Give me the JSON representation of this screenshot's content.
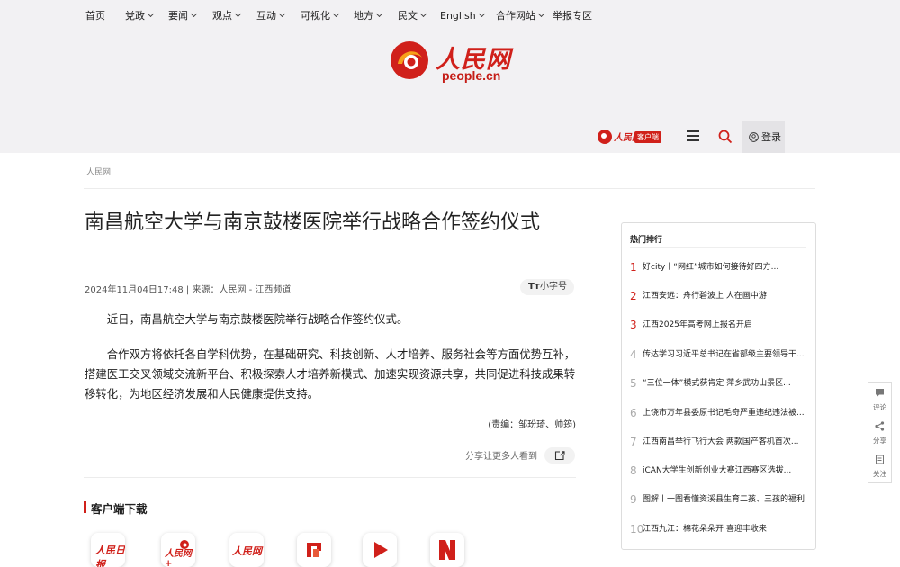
{
  "header": {
    "logo_cn": "人民网",
    "logo_en": "people.cn"
  },
  "nav": {
    "items": [
      {
        "label": "首页",
        "dropdown": false
      },
      {
        "label": "党政",
        "dropdown": true
      },
      {
        "label": "要闻",
        "dropdown": true
      },
      {
        "label": "观点",
        "dropdown": true
      },
      {
        "label": "互动",
        "dropdown": true
      },
      {
        "label": "可视化",
        "dropdown": true
      },
      {
        "label": "地方",
        "dropdown": true
      },
      {
        "label": "民文",
        "dropdown": true
      },
      {
        "label": "English",
        "dropdown": true
      },
      {
        "label": "合作网站",
        "dropdown": true
      },
      {
        "label": "举报专区",
        "dropdown": false
      }
    ],
    "app_badge_brand": "人民网+",
    "app_badge_tag": "客户端",
    "menu_icon": "hamburger-icon",
    "search_icon": "search-icon",
    "login_label": "登录",
    "accent_color": "#d0201a"
  },
  "breadcrumb": "人民网",
  "article": {
    "title": "南昌航空大学与南京鼓楼医院举行战略合作签约仪式",
    "meta": "2024年11月04日17:48 | 来源：人民网 - 江西频道",
    "font_toggle_glyph": "Tт",
    "font_toggle_label": "小字号",
    "paragraphs": [
      "近日，南昌航空大学与南京鼓楼医院举行战略合作签约仪式。",
      "合作双方将依托各自学科优势，在基础研究、科技创新、人才培养、服务社会等方面优势互补，搭建医工交叉领域交流新平台、积极探索人才培养新模式、加速实现资源共享，共同促进科技成果转移转化，为地区经济发展和人民健康提供支持。"
    ],
    "editor": "(责编：邹玢琦、帅筠)",
    "share_text": "分享让更多人看到"
  },
  "downloads": {
    "title": "客户端下载",
    "apps": [
      "人民日报",
      "人民网+",
      "人民网",
      "人民智云",
      "人民视频",
      "人民号"
    ]
  },
  "hot": {
    "title": "热门排行",
    "items": [
      {
        "rank": "1",
        "text": "好city丨“网红”城市如何接待好四方..."
      },
      {
        "rank": "2",
        "text": "江西安远：舟行碧波上 人在画中游"
      },
      {
        "rank": "3",
        "text": "江西2025年高考网上报名开启"
      },
      {
        "rank": "4",
        "text": "传达学习习近平总书记在省部级主要领导干..."
      },
      {
        "rank": "5",
        "text": "“三位一体”模式获肯定 萍乡武功山景区..."
      },
      {
        "rank": "6",
        "text": "上饶市万年县委原书记毛奇严重违纪违法被..."
      },
      {
        "rank": "7",
        "text": "江西南昌举行飞行大会 两款国产客机首次..."
      },
      {
        "rank": "8",
        "text": "iCAN大学生创新创业大赛江西赛区选拔..."
      },
      {
        "rank": "9",
        "text": "图解丨一图看懂资溪县生育二孩、三孩的福利"
      },
      {
        "rank": "10",
        "text": "江西九江：棉花朵朵开 喜迎丰收来"
      }
    ]
  },
  "side_tools": [
    {
      "label": "评论",
      "icon": "comment-icon"
    },
    {
      "label": "分享",
      "icon": "share-icon"
    },
    {
      "label": "关注",
      "icon": "follow-icon"
    }
  ]
}
